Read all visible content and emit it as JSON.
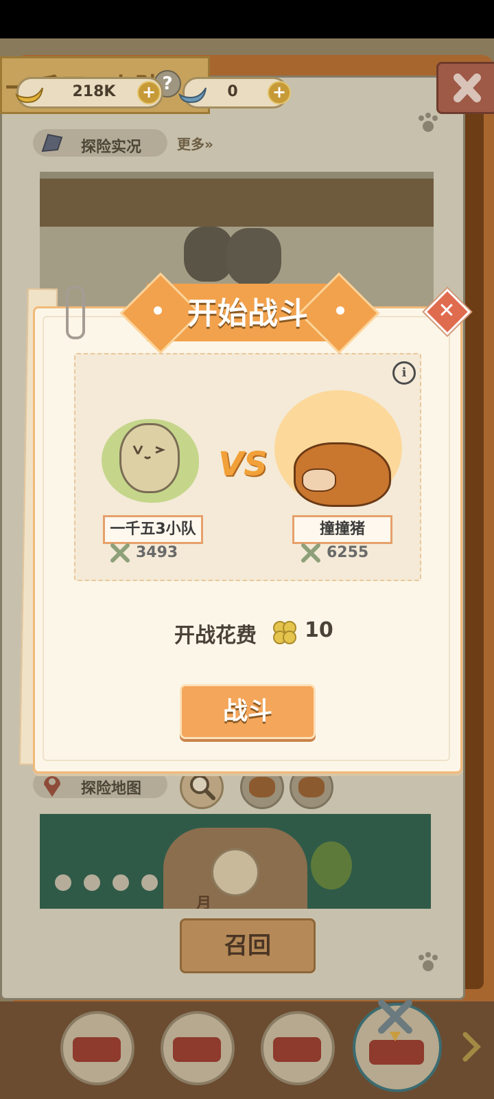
{
  "team": {
    "title": "一千五3小队"
  },
  "currencies": [
    {
      "name": "banana",
      "icon": "banana-icon",
      "value": "218K"
    },
    {
      "name": "blue-banana",
      "icon": "blue-banana-icon",
      "value": "0"
    }
  ],
  "sections": {
    "live": {
      "label": "探险实况",
      "more": "更多»"
    },
    "map": {
      "label": "探险地图",
      "location_text": "月"
    }
  },
  "recall": {
    "label": "召回"
  },
  "modal": {
    "title": "开始战斗",
    "player": {
      "name": "一千五3小队",
      "power": "3493"
    },
    "enemy": {
      "name": "撞撞猪",
      "power": "6255"
    },
    "vs_text": "VS",
    "cost_label": "开战花费",
    "cost_value": "10",
    "cost_icon": "clover-icon",
    "fight_label": "战斗"
  },
  "colors": {
    "accent_orange": "#f2a24d",
    "modal_bg": "#fcf6e8",
    "close_red": "#e06c50"
  }
}
